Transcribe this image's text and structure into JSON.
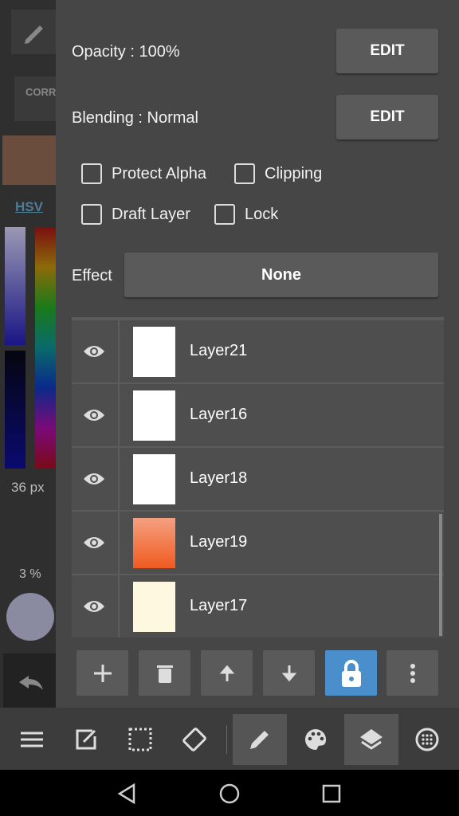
{
  "side": {
    "corr_label": "CORR",
    "hsv_label": "HSV",
    "brush_size": "36 px",
    "opacity": "3 %"
  },
  "panel": {
    "opacity_label": "Opacity : 100%",
    "opacity_edit": "EDIT",
    "blending_label": "Blending : Normal",
    "blending_edit": "EDIT",
    "checkboxes": [
      {
        "label": "Protect Alpha",
        "checked": false
      },
      {
        "label": "Clipping",
        "checked": false
      },
      {
        "label": "Draft Layer",
        "checked": false
      },
      {
        "label": "Lock",
        "checked": false
      }
    ],
    "effect_label": "Effect",
    "effect_value": "None"
  },
  "layers": [
    {
      "name": "Layer21",
      "visible": true,
      "thumb": "#ffffff"
    },
    {
      "name": "Layer16",
      "visible": true,
      "thumb": "#ffffff"
    },
    {
      "name": "Layer18",
      "visible": true,
      "thumb": "#ffffff"
    },
    {
      "name": "Layer19",
      "visible": true,
      "thumb": "#f26a35"
    },
    {
      "name": "Layer17",
      "visible": true,
      "thumb": "#fff8e0"
    }
  ],
  "colors": {
    "accent": "#4a8fcb",
    "panel": "#464646"
  },
  "layer_toolbar": [
    "add-icon",
    "trash-icon",
    "arrow-up-icon",
    "arrow-down-icon",
    "lock-icon",
    "more-icon"
  ],
  "bottom_toolbar": [
    "menu-icon",
    "edit-icon",
    "selection-icon",
    "rotate-icon",
    "pen-icon",
    "palette-icon",
    "layers-icon",
    "grid-icon"
  ]
}
